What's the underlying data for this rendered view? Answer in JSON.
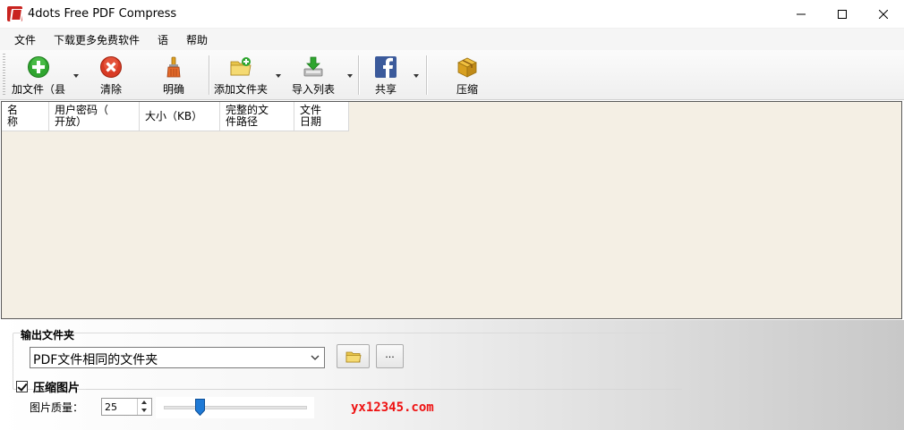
{
  "window": {
    "title": "4dots Free PDF Compress"
  },
  "menu": {
    "items": [
      {
        "label": "文件"
      },
      {
        "label": "下载更多免费软件"
      },
      {
        "label": "语"
      },
      {
        "label": "帮助"
      }
    ]
  },
  "toolbar": {
    "add_files": "加文件（县",
    "clear": "清除",
    "clear_all": "明确",
    "add_folder": "添加文件夹",
    "import_list": "导入列表",
    "share": "共享",
    "compress": "压缩"
  },
  "file_list": {
    "columns": [
      {
        "line1": "名",
        "line2": "称"
      },
      {
        "line1": "用户密码（",
        "line2": "开放）"
      },
      {
        "line1": "大小（KB）",
        "line2": ""
      },
      {
        "line1": "完整的文",
        "line2": "件路径"
      },
      {
        "line1": "文件",
        "line2": "日期"
      }
    ],
    "rows": []
  },
  "output": {
    "group_title": "输出文件夹",
    "selected": "PDF文件相同的文件夹",
    "browse_label": "..."
  },
  "compress_images": {
    "label": "压缩图片",
    "checked": true,
    "quality_label": "图片质量：",
    "quality_value": "25",
    "quality_fraction": 0.25
  },
  "watermark": "yx12345.com",
  "icons": {
    "add": "plus-circle-icon",
    "clear": "red-x-circle-icon",
    "clear_all": "brush-icon",
    "add_folder": "folder-add-icon",
    "import_list": "import-icon",
    "share": "facebook-icon",
    "compress": "package-icon"
  },
  "colors": {
    "list_bg": "#f4efe4",
    "watermark": "#ee1111",
    "add_green": "#2fa52f",
    "clear_red": "#d83a24",
    "facebook": "#3b5a9b"
  }
}
